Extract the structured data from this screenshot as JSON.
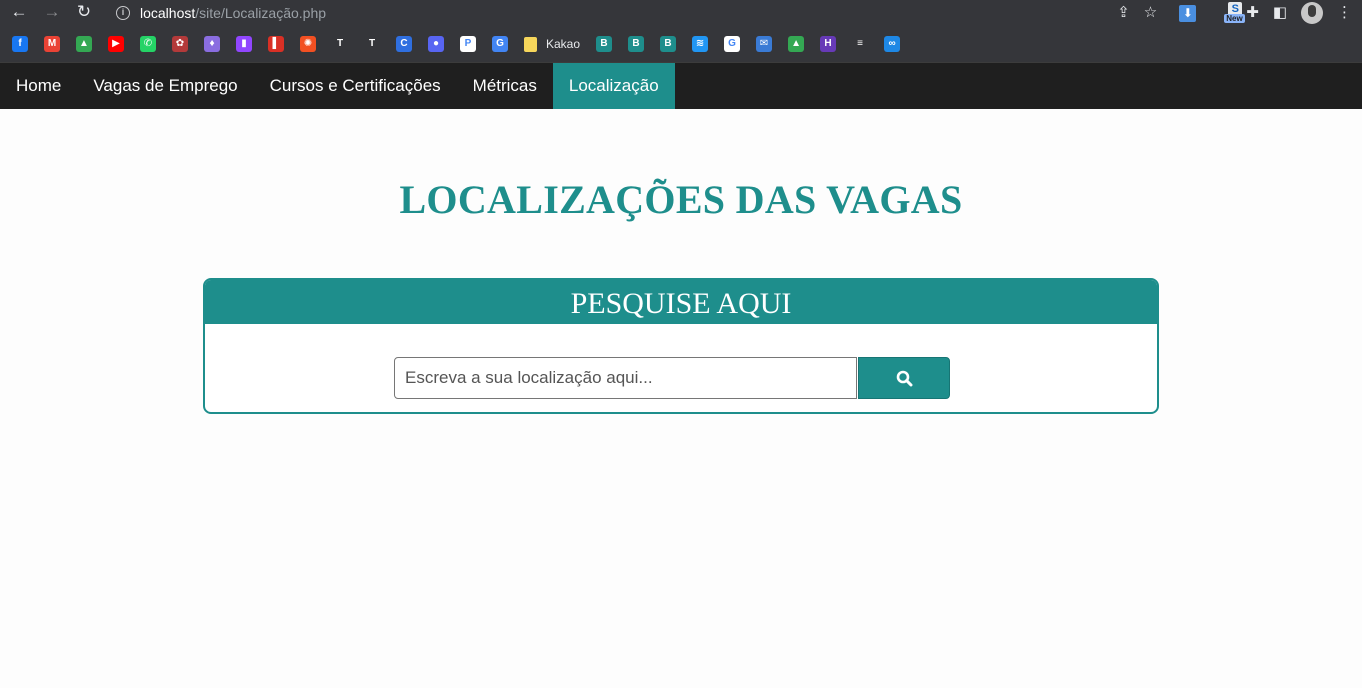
{
  "browser": {
    "url_host": "localhost",
    "url_path": "/site/Localização.php",
    "new_badge": "New",
    "bookmarks": [
      {
        "icon": "facebook-icon",
        "color": "#1877f2",
        "glyph": "f"
      },
      {
        "icon": "gmail-icon",
        "color": "#ea4335",
        "glyph": "M"
      },
      {
        "icon": "drive-icon",
        "color": "#34a853",
        "glyph": "▲"
      },
      {
        "icon": "youtube-music-icon",
        "color": "#ff0000",
        "glyph": "▶"
      },
      {
        "icon": "whatsapp-icon",
        "color": "#25d366",
        "glyph": "✆"
      },
      {
        "icon": "anime-icon",
        "color": "#b33a3a",
        "glyph": "✿"
      },
      {
        "icon": "crystal-icon",
        "color": "#8a6de0",
        "glyph": "♦"
      },
      {
        "icon": "twitch-icon",
        "color": "#9146ff",
        "glyph": "▮"
      },
      {
        "icon": "book-icon",
        "color": "#d93025",
        "glyph": "▌"
      },
      {
        "icon": "pinwheel-icon",
        "color": "#f25022",
        "glyph": "✺"
      },
      {
        "icon": "tcs-icon",
        "color": "#35363a",
        "glyph": "T"
      },
      {
        "icon": "tcs-icon-2",
        "color": "#35363a",
        "glyph": "T"
      },
      {
        "icon": "canva-icon",
        "color": "#2f6fe0",
        "glyph": "C"
      },
      {
        "icon": "discord-icon",
        "color": "#5865f2",
        "glyph": "●"
      },
      {
        "icon": "pj-icon",
        "color": "#ffffff",
        "glyph": "P"
      },
      {
        "icon": "translate-icon",
        "color": "#4285f4",
        "glyph": "G"
      }
    ],
    "kakao_label": "Kakao",
    "bookmarks_after": [
      {
        "icon": "bold-b-icon",
        "color": "#1e8e8c",
        "glyph": "B"
      },
      {
        "icon": "bold-b-icon-2",
        "color": "#1e8e8c",
        "glyph": "B"
      },
      {
        "icon": "bold-b-icon-3",
        "color": "#1e8e8c",
        "glyph": "B"
      },
      {
        "icon": "stack-icon",
        "color": "#2196f3",
        "glyph": "≋"
      },
      {
        "icon": "google-icon",
        "color": "#ffffff",
        "glyph": "G"
      },
      {
        "icon": "chat-icon",
        "color": "#3a7bd5",
        "glyph": "✉"
      },
      {
        "icon": "drive-icon-2",
        "color": "#34a853",
        "glyph": "▲"
      },
      {
        "icon": "h-icon",
        "color": "#673ab7",
        "glyph": "H"
      },
      {
        "icon": "text-logo-icon",
        "color": "#35363a",
        "glyph": "≡"
      },
      {
        "icon": "link-icon",
        "color": "#1e88e5",
        "glyph": "∞"
      }
    ]
  },
  "nav": {
    "items": [
      {
        "label": "Home"
      },
      {
        "label": "Vagas de Emprego"
      },
      {
        "label": "Cursos e Certificações"
      },
      {
        "label": "Métricas"
      },
      {
        "label": "Localização",
        "active": true
      }
    ]
  },
  "main": {
    "title": "LOCALIZAÇÕES DAS VAGAS",
    "search_header": "PESQUISE AQUI",
    "search_placeholder": "Escreva a sua localização aqui...",
    "search_value": ""
  },
  "colors": {
    "accent": "#1e8e8c",
    "nav_bg": "#1f1f1f",
    "chrome_bg": "#35363a"
  }
}
